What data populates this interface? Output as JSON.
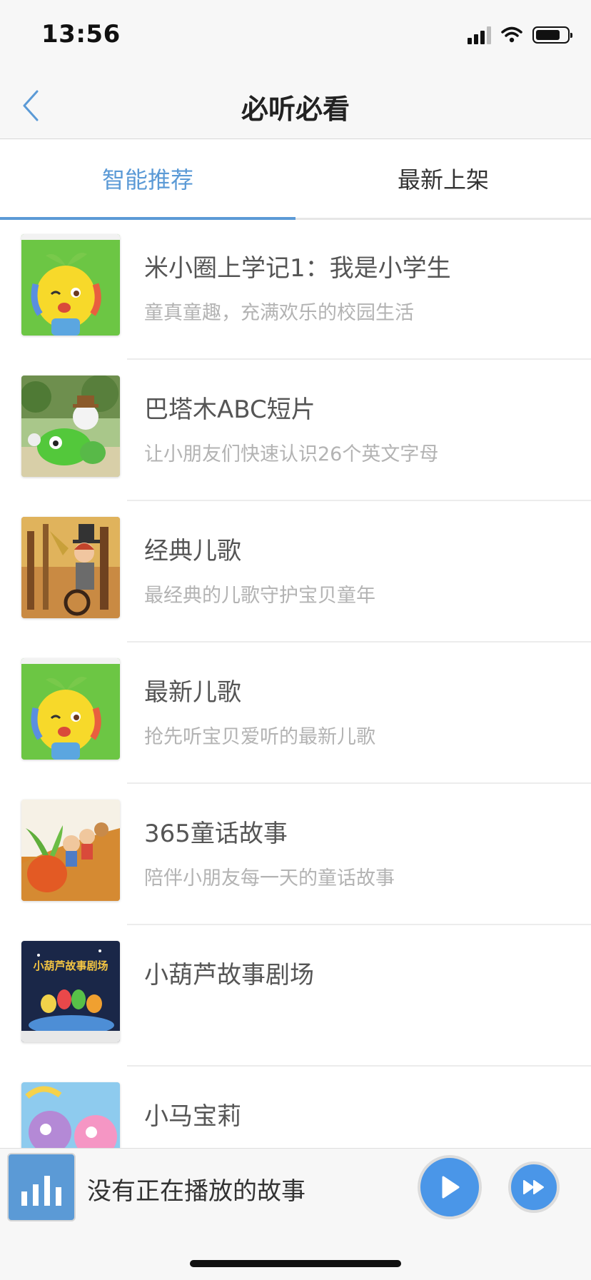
{
  "status_bar": {
    "time": "13:56",
    "battery_level": 0.78
  },
  "nav": {
    "title": "必听必看",
    "back_icon": "chevron-left-icon"
  },
  "tabs": [
    {
      "label": "智能推荐",
      "active": true
    },
    {
      "label": "最新上架",
      "active": false
    }
  ],
  "items": [
    {
      "title": "米小圈上学记1：我是小学生",
      "subtitle": "童真童趣，充满欢乐的校园生活"
    },
    {
      "title": "巴塔木ABC短片",
      "subtitle": "让小朋友们快速认识26个英文字母"
    },
    {
      "title": "经典儿歌",
      "subtitle": "最经典的儿歌守护宝贝童年"
    },
    {
      "title": "最新儿歌",
      "subtitle": "抢先听宝贝爱听的最新儿歌"
    },
    {
      "title": "365童话故事",
      "subtitle": "陪伴小朋友每一天的童话故事"
    },
    {
      "title": "小葫芦故事剧场",
      "subtitle": "",
      "thumb_text": "小葫芦故事剧场"
    },
    {
      "title": "小马宝莉",
      "subtitle": ""
    }
  ],
  "player": {
    "status_text": "没有正在播放的故事",
    "play_icon": "play-icon",
    "next_icon": "fast-forward-icon"
  },
  "colors": {
    "accent": "#5b9ad6",
    "player_button": "#4a96e8"
  }
}
